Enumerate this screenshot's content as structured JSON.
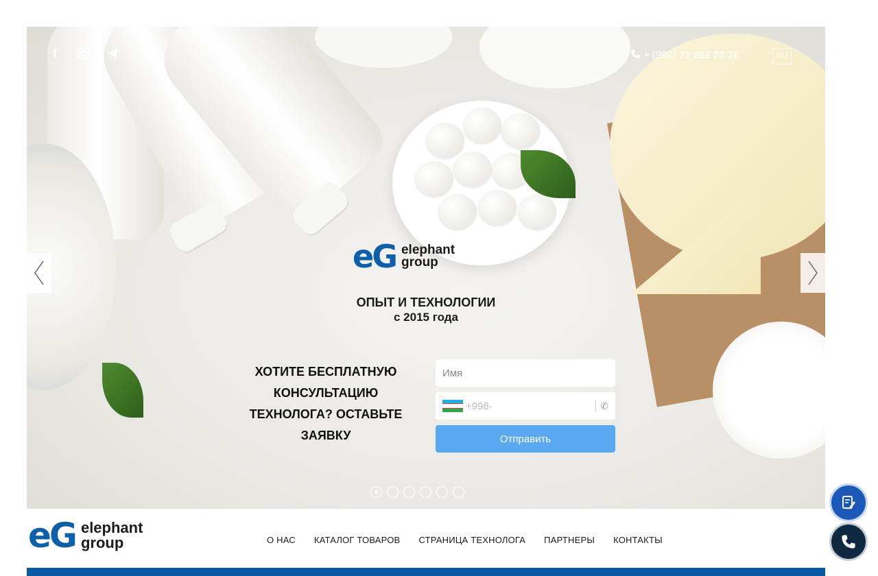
{
  "social": {
    "facebook": "f",
    "instagram": "instagram-icon",
    "telegram": "telegram-icon"
  },
  "header": {
    "phone_prefix": "+ (998) 71 ",
    "phone_number": "262 73 76",
    "language": "RU"
  },
  "brand": {
    "mark": "eG",
    "line1": "elephant",
    "line2": "group"
  },
  "hero": {
    "tagline_1": "ОПЫТ И ТЕХНОЛОГИИ",
    "tagline_2": "с 2015 года",
    "cta_text": "ХОТИТЕ БЕСПЛАТНУЮ КОНСУЛЬТАЦИЮ ТЕХНОЛОГА? ОСТАВЬТЕ ЗАЯВКУ",
    "name_placeholder": "Имя",
    "phone_placeholder": "+998-",
    "submit_label": "Отправить",
    "slides_total": 6,
    "slide_active": 1
  },
  "nav": {
    "items": [
      {
        "label": "О НАС"
      },
      {
        "label": "КАТАЛОГ ТОВАРОВ"
      },
      {
        "label": "СТРАНИЦА ТЕХНОЛОГА"
      },
      {
        "label": "ПАРТНЕРЫ"
      },
      {
        "label": "КОНТАКТЫ"
      }
    ]
  },
  "colors": {
    "brand_blue": "#0d5fa8",
    "button_blue": "#5aa8f0",
    "bar_blue": "#0a5aa3"
  }
}
